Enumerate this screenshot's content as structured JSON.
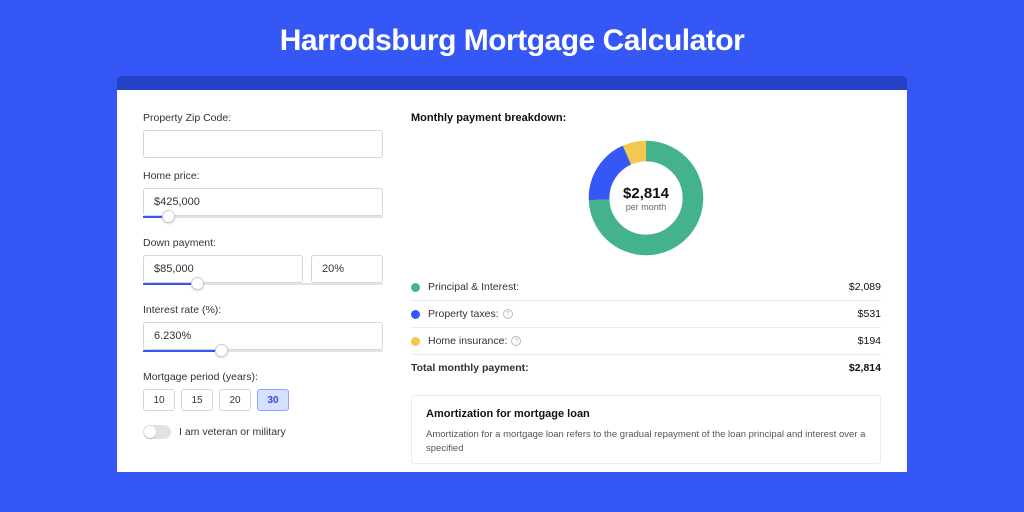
{
  "title": "Harrodsburg Mortgage Calculator",
  "colors": {
    "principal": "#44b38c",
    "taxes": "#3457f5",
    "insurance": "#f2c94c"
  },
  "form": {
    "zip_label": "Property Zip Code:",
    "zip_value": "",
    "home_price_label": "Home price:",
    "home_price_value": "$425,000",
    "home_price_slider_pct": 8,
    "down_payment_label": "Down payment:",
    "down_payment_value": "$85,000",
    "down_payment_pct": "20%",
    "down_payment_slider_pct": 20,
    "interest_label": "Interest rate (%):",
    "interest_value": "6.230%",
    "interest_slider_pct": 30,
    "period_label": "Mortgage period (years):",
    "periods": [
      "10",
      "15",
      "20",
      "30"
    ],
    "period_active": "30",
    "veteran_label": "I am veteran or military"
  },
  "breakdown": {
    "title": "Monthly payment breakdown:",
    "amount": "$2,814",
    "per": "per month",
    "rows": [
      {
        "key": "principal",
        "label": "Principal & Interest:",
        "value": "$2,089",
        "info": false,
        "color": "#44b38c"
      },
      {
        "key": "taxes",
        "label": "Property taxes:",
        "value": "$531",
        "info": true,
        "color": "#3457f5"
      },
      {
        "key": "insurance",
        "label": "Home insurance:",
        "value": "$194",
        "info": true,
        "color": "#f2c94c"
      }
    ],
    "total_label": "Total monthly payment:",
    "total_value": "$2,814"
  },
  "chart_data": {
    "type": "pie",
    "title": "Monthly payment breakdown",
    "categories": [
      "Principal & Interest",
      "Property taxes",
      "Home insurance"
    ],
    "values": [
      2089,
      531,
      194
    ],
    "total": 2814
  },
  "amortization": {
    "title": "Amortization for mortgage loan",
    "text": "Amortization for a mortgage loan refers to the gradual repayment of the loan principal and interest over a specified"
  }
}
